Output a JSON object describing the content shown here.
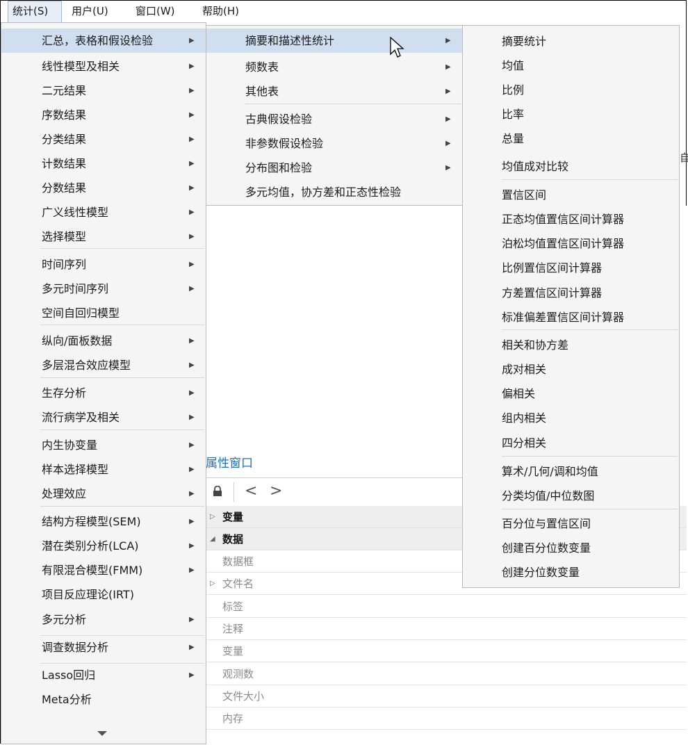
{
  "menubar": {
    "items": [
      {
        "label": "统计(S)",
        "active": true
      },
      {
        "label": "用户(U)"
      },
      {
        "label": "窗口(W)"
      },
      {
        "label": "帮助(H)"
      }
    ]
  },
  "main_menu": {
    "items": [
      {
        "label": "汇总，表格和假设检验",
        "submenu": true,
        "highlighted": true
      },
      {
        "label": "线性模型及相关",
        "submenu": true
      },
      {
        "label": "二元结果",
        "submenu": true
      },
      {
        "label": "序数结果",
        "submenu": true
      },
      {
        "label": "分类结果",
        "submenu": true
      },
      {
        "label": "计数结果",
        "submenu": true
      },
      {
        "label": "分数结果",
        "submenu": true
      },
      {
        "label": "广义线性模型",
        "submenu": true
      },
      {
        "label": "选择模型",
        "submenu": true
      },
      {
        "label": "时间序列",
        "submenu": true
      },
      {
        "label": "多元时间序列",
        "submenu": true
      },
      {
        "label": "空间自回归模型",
        "submenu": false
      },
      {
        "label": "纵向/面板数据",
        "submenu": true
      },
      {
        "label": "多层混合效应模型",
        "submenu": true
      },
      {
        "label": "生存分析",
        "submenu": true
      },
      {
        "label": "流行病学及相关",
        "submenu": true
      },
      {
        "label": "内生协变量",
        "submenu": true
      },
      {
        "label": "样本选择模型",
        "submenu": true
      },
      {
        "label": "处理效应",
        "submenu": true
      },
      {
        "label": "结构方程模型(SEM)",
        "submenu": true
      },
      {
        "label": "潜在类别分析(LCA)",
        "submenu": true
      },
      {
        "label": "有限混合模型(FMM)",
        "submenu": true
      },
      {
        "label": "项目反应理论(IRT)",
        "submenu": false
      },
      {
        "label": "多元分析",
        "submenu": true
      },
      {
        "label": "调查数据分析",
        "submenu": true
      },
      {
        "label": "Lasso回归",
        "submenu": true
      },
      {
        "label": "Meta分析",
        "submenu": false
      }
    ]
  },
  "submenu_1": {
    "items": [
      {
        "label": "摘要和描述性统计",
        "submenu": true,
        "highlighted": true
      },
      {
        "label": "频数表",
        "submenu": true
      },
      {
        "label": "其他表",
        "submenu": true
      },
      {
        "label": "古典假设检验",
        "submenu": true
      },
      {
        "label": "非参数假设检验",
        "submenu": true
      },
      {
        "label": "分布图和检验",
        "submenu": true
      },
      {
        "label": "多元均值，协方差和正态性检验",
        "submenu": false
      }
    ]
  },
  "submenu_2": {
    "items": [
      {
        "label": "摘要统计"
      },
      {
        "label": "均值"
      },
      {
        "label": "比例"
      },
      {
        "label": "比率"
      },
      {
        "label": "总量"
      },
      {
        "label": "均值成对比较"
      },
      {
        "label": "置信区间"
      },
      {
        "label": "正态均值置信区间计算器"
      },
      {
        "label": "泊松均值置信区间计算器"
      },
      {
        "label": "比例置信区间计算器"
      },
      {
        "label": "方差置信区间计算器"
      },
      {
        "label": "标准偏差置信区间计算器"
      },
      {
        "label": "相关和协方差"
      },
      {
        "label": "成对相关"
      },
      {
        "label": "偏相关"
      },
      {
        "label": "组内相关"
      },
      {
        "label": "四分相关"
      },
      {
        "label": "算术/几何/调和均值"
      },
      {
        "label": "分类均值/中位数图"
      },
      {
        "label": "百分位与置信区间"
      },
      {
        "label": "创建百分位数变量"
      },
      {
        "label": "创建分位数变量"
      }
    ]
  },
  "properties": {
    "title": "属性窗口",
    "back_label": "<",
    "forward_label": ">",
    "cat_variables": "变量",
    "cat_data": "数据",
    "fields": [
      "数据框",
      "文件名",
      "标签",
      "注释",
      "变量",
      "观测数",
      "文件大小",
      "内存"
    ]
  },
  "glyphs": {
    "submenu_arrow": "▶",
    "expand_closed": "▷",
    "expand_open": "◢",
    "edge_char": "自"
  }
}
